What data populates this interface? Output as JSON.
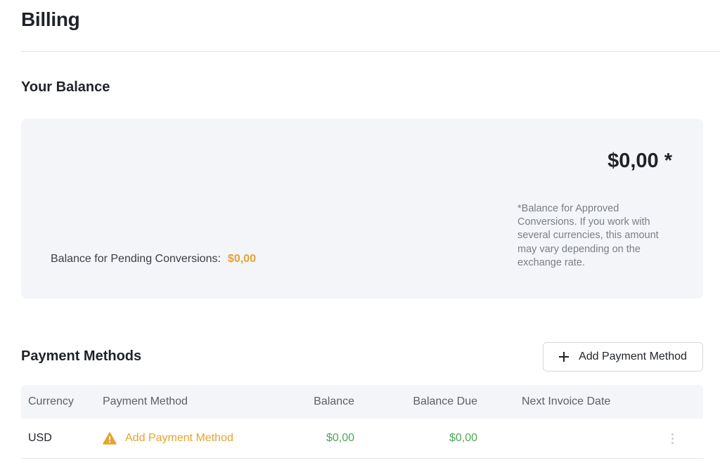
{
  "page": {
    "title": "Billing"
  },
  "balance": {
    "heading": "Your Balance",
    "approved_amount": "$0,00 *",
    "note": "*Balance for Approved Conversions. If you work with several currencies, this amount may vary depending on the exchange rate.",
    "pending_label": "Balance for Pending Conversions:",
    "pending_value": "$0,00"
  },
  "payment_methods": {
    "heading": "Payment Methods",
    "add_button_label": "Add Payment Method",
    "columns": {
      "currency": "Currency",
      "method": "Payment Method",
      "balance": "Balance",
      "balance_due": "Balance Due",
      "next_invoice_date": "Next Invoice Date"
    },
    "rows": [
      {
        "currency": "USD",
        "method_label": "Add Payment Method",
        "method_icon": "warning-icon",
        "balance": "$0,00",
        "balance_due": "$0,00",
        "next_invoice_date": ""
      }
    ]
  },
  "colors": {
    "accent_orange": "#e5a331",
    "positive_green": "#4ea85a",
    "card_background": "#f4f5f8"
  }
}
